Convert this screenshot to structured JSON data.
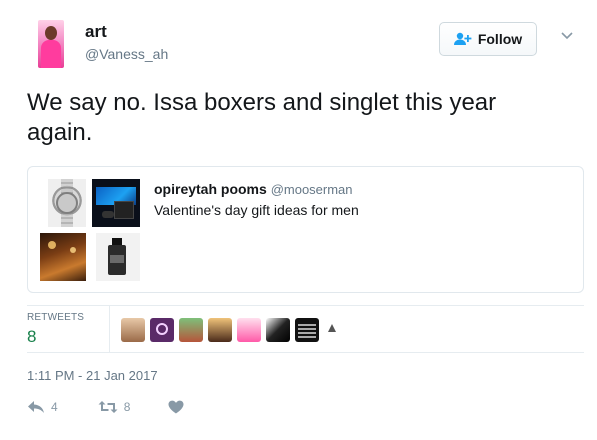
{
  "user": {
    "display_name": "art",
    "handle": "@Vaness_ah"
  },
  "follow_button": {
    "label": "Follow"
  },
  "tweet": {
    "text": "We say no. Issa boxers and singlet this year again."
  },
  "quoted_tweet": {
    "name": "opireytah pooms",
    "handle": "@mooserman",
    "text": "Valentine's day gift ideas for men"
  },
  "stats": {
    "retweets_label": "RETWEETS",
    "retweets_count": "8"
  },
  "timestamp": "1:11 PM - 21 Jan 2017",
  "actions": {
    "reply_count": "4",
    "retweet_count": "8"
  },
  "colors": {
    "accent": "#1da1f2",
    "retweet_green": "#17804a",
    "muted": "#657786"
  }
}
